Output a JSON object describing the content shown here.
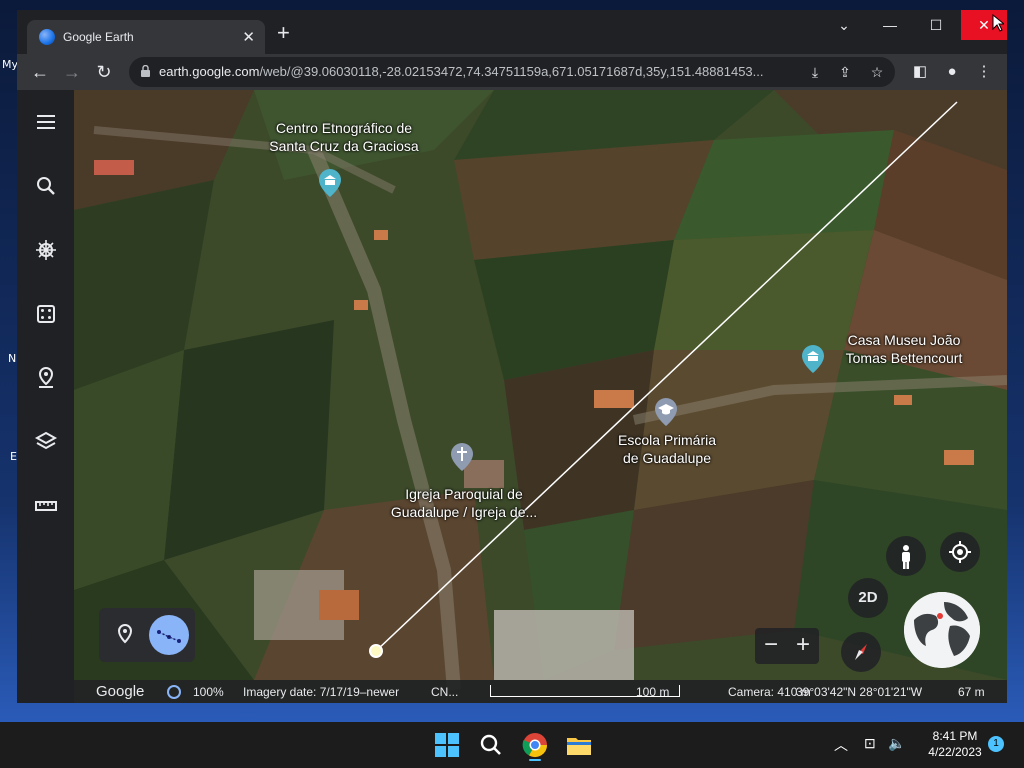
{
  "desktop": {
    "fragments": [
      "My",
      "N",
      "E"
    ]
  },
  "browser": {
    "tab_title": "Google Earth",
    "tab_close": "✕",
    "new_tab": "+",
    "url_domain": "earth.google.com",
    "url_path": "/web/@39.06030118,-28.02153472,74.34751159a,671.05171687d,35y,151.48881453..."
  },
  "map": {
    "labels": {
      "centro": "Centro Etnográfico de\nSanta Cruz da Graciosa",
      "casa": "Casa Museu João\nTomas Bettencourt",
      "escola": "Escola Primária\nde Guadalupe",
      "igreja": "Igreja Paroquial de\nGuadalupe / Igreja de..."
    },
    "view_mode_label": "2D"
  },
  "status": {
    "logo": "Google",
    "percent": "100%",
    "imagery_date": "Imagery date: 7/17/19–newer",
    "attribution": "CN...",
    "scale": "100 m",
    "camera": "Camera: 410 m",
    "coords": "39°03'42\"N 28°01'21\"W",
    "elevation": "67 m"
  },
  "taskbar": {
    "time": "8:41 PM",
    "date": "4/22/2023",
    "notifications": "1"
  },
  "colors": {
    "close_red": "#e81123",
    "accent_blue": "#8ab4f8",
    "pin_teal": "#4fb3c9",
    "pin_gray": "#8e9bb0"
  }
}
